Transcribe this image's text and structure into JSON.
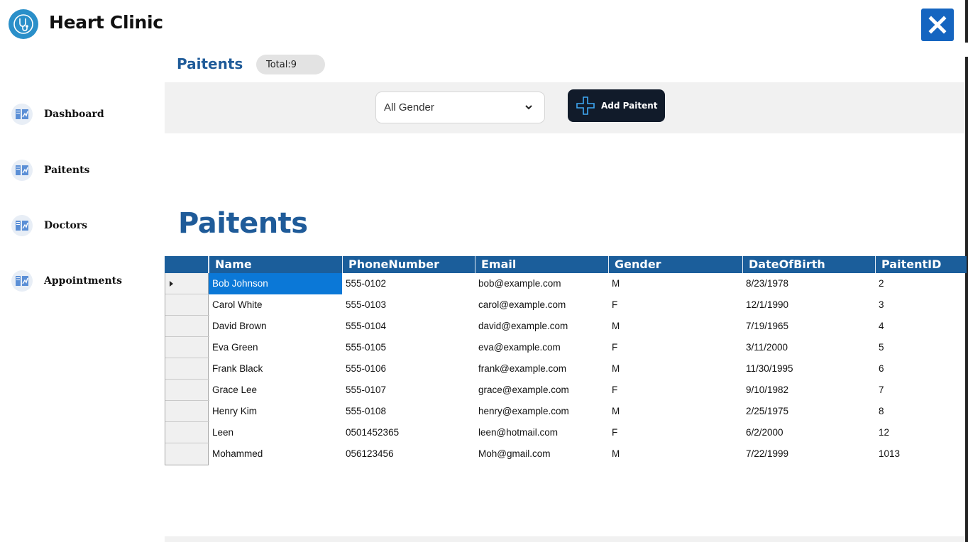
{
  "app": {
    "title": "Heart Clinic",
    "logo_icon": "stethoscope-icon",
    "close_icon": "close-icon",
    "accent_color": "#1565c0"
  },
  "sidebar": {
    "items": [
      {
        "label": "Dashboard",
        "icon": "report-icon"
      },
      {
        "label": "Paitents",
        "icon": "report-icon"
      },
      {
        "label": "Doctors",
        "icon": "report-icon"
      },
      {
        "label": "Appointments",
        "icon": "report-icon"
      }
    ]
  },
  "header": {
    "section_title": "Paitents",
    "total_label": "Total:9"
  },
  "filters": {
    "gender_selected": "All Gender",
    "add_button_label": "Add Paitent",
    "add_icon": "plus-icon"
  },
  "main": {
    "title": "Paitents"
  },
  "table": {
    "columns": [
      "Name",
      "PhoneNumber",
      "Email",
      "Gender",
      "DateOfBirth",
      "PaitentID"
    ],
    "rows": [
      [
        "Bob Johnson",
        "555-0102",
        "bob@example.com",
        "M",
        "8/23/1978",
        "2"
      ],
      [
        "Carol White",
        "555-0103",
        "carol@example.com",
        "F",
        "12/1/1990",
        "3"
      ],
      [
        "David Brown",
        "555-0104",
        "david@example.com",
        "M",
        "7/19/1965",
        "4"
      ],
      [
        "Eva Green",
        "555-0105",
        "eva@example.com",
        "F",
        "3/11/2000",
        "5"
      ],
      [
        "Frank Black",
        "555-0106",
        "frank@example.com",
        "M",
        "11/30/1995",
        "6"
      ],
      [
        "Grace Lee",
        "555-0107",
        "grace@example.com",
        "F",
        "9/10/1982",
        "7"
      ],
      [
        "Henry Kim",
        "555-0108",
        "henry@example.com",
        "M",
        "2/25/1975",
        "8"
      ],
      [
        "Leen",
        "0501452365",
        "leen@hotmail.com",
        "F",
        "6/2/2000",
        "12"
      ],
      [
        "Mohammed",
        "056123456",
        "Moh@gmail.com",
        "M",
        "7/22/1999",
        "1013"
      ]
    ],
    "selected_row": 0,
    "header_color": "#1b5e9b",
    "selection_color": "#0b78d7"
  }
}
